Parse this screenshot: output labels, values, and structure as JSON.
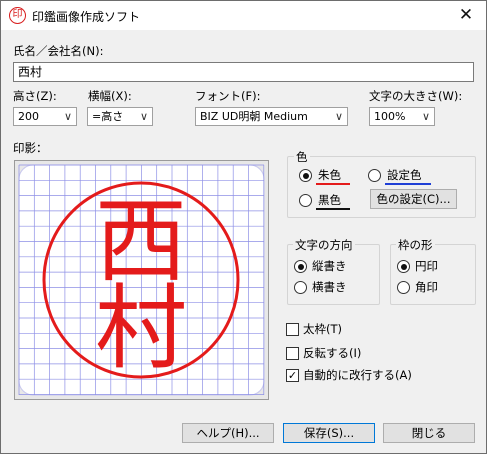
{
  "window": {
    "title": "印鑑画像作成ソフト",
    "icon_char": "印",
    "close_glyph": "✕"
  },
  "name_field": {
    "label": "氏名／会社名(N):",
    "value": "西村"
  },
  "height_combo": {
    "label": "高さ(Z):",
    "value": "200",
    "arrow": "∨"
  },
  "width_combo": {
    "label": "横幅(X):",
    "value": "=高さ",
    "arrow": "∨"
  },
  "font_combo": {
    "label": "フォント(F):",
    "value": "BIZ UD明朝 Medium",
    "arrow": "∨"
  },
  "size_combo": {
    "label": "文字の大きさ(W):",
    "value": "100%",
    "arrow": "∨"
  },
  "preview": {
    "label": "印影：",
    "chars": [
      "西",
      "村"
    ],
    "ink_color": "#e41b1b",
    "grid_color": "#8d8fe6"
  },
  "color_group": {
    "title": "色",
    "options": [
      {
        "label": "朱色",
        "selected": true,
        "underline_color": "#e41b1b"
      },
      {
        "label": "設定色",
        "selected": false,
        "underline_color": "#1f3fd6"
      },
      {
        "label": "黒色",
        "selected": false,
        "underline_color": "#111111"
      }
    ],
    "settings_button": "色の設定(C)..."
  },
  "direction_group": {
    "title": "文字の方向",
    "options": [
      {
        "label": "縦書き",
        "selected": true
      },
      {
        "label": "横書き",
        "selected": false
      }
    ]
  },
  "frame_group": {
    "title": "枠の形",
    "options": [
      {
        "label": "円印",
        "selected": true
      },
      {
        "label": "角印",
        "selected": false
      }
    ]
  },
  "checkboxes": [
    {
      "label": "太枠(T)",
      "checked": false
    },
    {
      "label": "反転する(I)",
      "checked": false
    },
    {
      "label": "自動的に改行する(A)",
      "checked": true
    }
  ],
  "check_glyph": "✓",
  "buttons": {
    "help": "ヘルプ(H)...",
    "save": "保存(S)...",
    "close": "閉じる"
  }
}
